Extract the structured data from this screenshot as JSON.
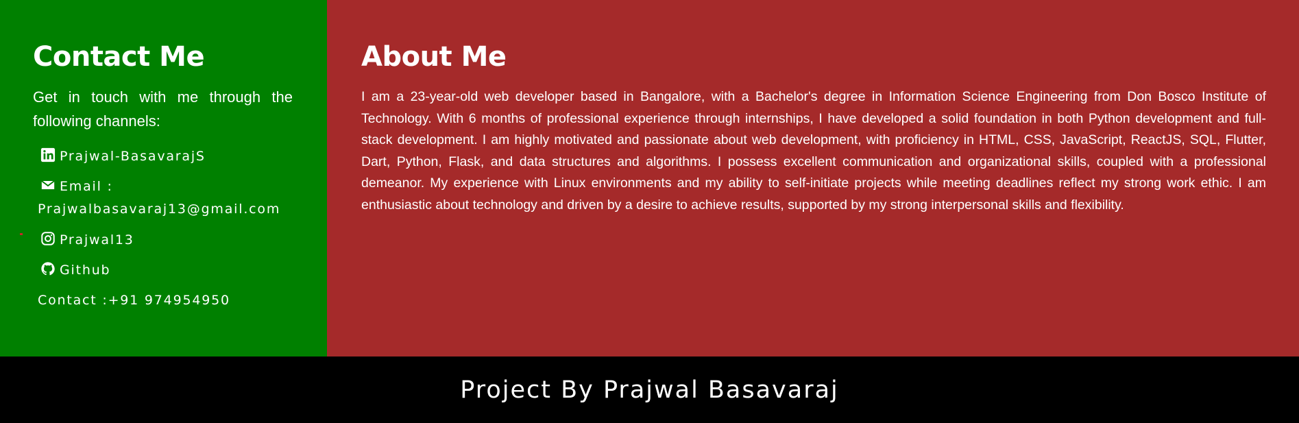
{
  "contact": {
    "title": "Contact Me",
    "intro": "Get in touch with me through the following channels:",
    "linkedin": {
      "icon": "linkedin-icon",
      "label": "Prajwal-BasavarajS"
    },
    "email": {
      "icon": "envelope-icon",
      "label": "Email :",
      "value": "Prajwalbasavaraj13@gmail.com"
    },
    "instagram": {
      "icon": "instagram-icon",
      "label": "Prajwal13"
    },
    "github": {
      "icon": "github-icon",
      "label": "Github"
    },
    "phone": {
      "label": "Contact :+91 974954950"
    }
  },
  "about": {
    "title": "About Me",
    "bio": "I am a 23-year-old web developer based in Bangalore, with a Bachelor's degree in Information Science Engineering from Don Bosco Institute of Technology. With 6 months of professional experience through internships, I have developed a solid foundation in both Python development and full-stack development. I am highly motivated and passionate about web development, with proficiency in HTML, CSS, JavaScript, ReactJS, SQL, Flutter, Dart, Python, Flask, and data structures and algorithms. I possess excellent communication and organizational skills, coupled with a professional demeanor. My experience with Linux environments and my ability to self-initiate projects while meeting deadlines reflect my strong work ethic. I am enthusiastic about technology and driven by a desire to achieve results, supported by my strong interpersonal skills and flexibility."
  },
  "footer": {
    "text": "Project By Prajwal Basavaraj"
  },
  "colors": {
    "contact_bg": "#008000",
    "about_bg": "#a52a2a",
    "footer_bg": "#000000",
    "text": "#ffffff"
  }
}
